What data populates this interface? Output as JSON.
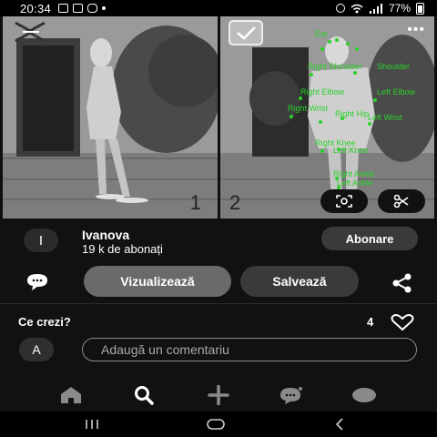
{
  "status_bar": {
    "time": "20:34",
    "battery": "77%"
  },
  "images": {
    "left_number": "1",
    "right_number": "2",
    "keypoints": [
      {
        "label": "Ear",
        "color": "#2bd12b"
      },
      {
        "label": "Right Shoulder",
        "color": "#2bd12b"
      },
      {
        "label": "Shoulder",
        "color": "#2bd12b"
      },
      {
        "label": "Right Elbow",
        "color": "#2bd12b"
      },
      {
        "label": "Left Elbow",
        "color": "#2bd12b"
      },
      {
        "label": "Right Wrist",
        "color": "#2bd12b"
      },
      {
        "label": "Right Hip",
        "color": "#2bd12b"
      },
      {
        "label": "Left Wrist",
        "color": "#2bd12b"
      },
      {
        "label": "Right Knee",
        "color": "#2bd12b"
      },
      {
        "label": "Left Knee",
        "color": "#2bd12b"
      },
      {
        "label": "Right Ankle",
        "color": "#2bd12b"
      },
      {
        "label": "Left Ankle",
        "color": "#2bd12b"
      }
    ]
  },
  "profile": {
    "avatar_initial": "I",
    "name": "Ivanova",
    "followers": "19 k de abonați",
    "follow_label": "Abonare"
  },
  "actions": {
    "view_label": "Vizualizează",
    "save_label": "Salvează"
  },
  "comments": {
    "title": "Ce crezi?",
    "like_count": "4",
    "avatar_initial": "A",
    "input_placeholder": "Adaugă un comentariu"
  },
  "colors": {
    "background": "#111111",
    "keypoint_green": "#2bd12b",
    "primary_button": "#6a6a6a",
    "secondary_button": "#3a3a3a"
  }
}
